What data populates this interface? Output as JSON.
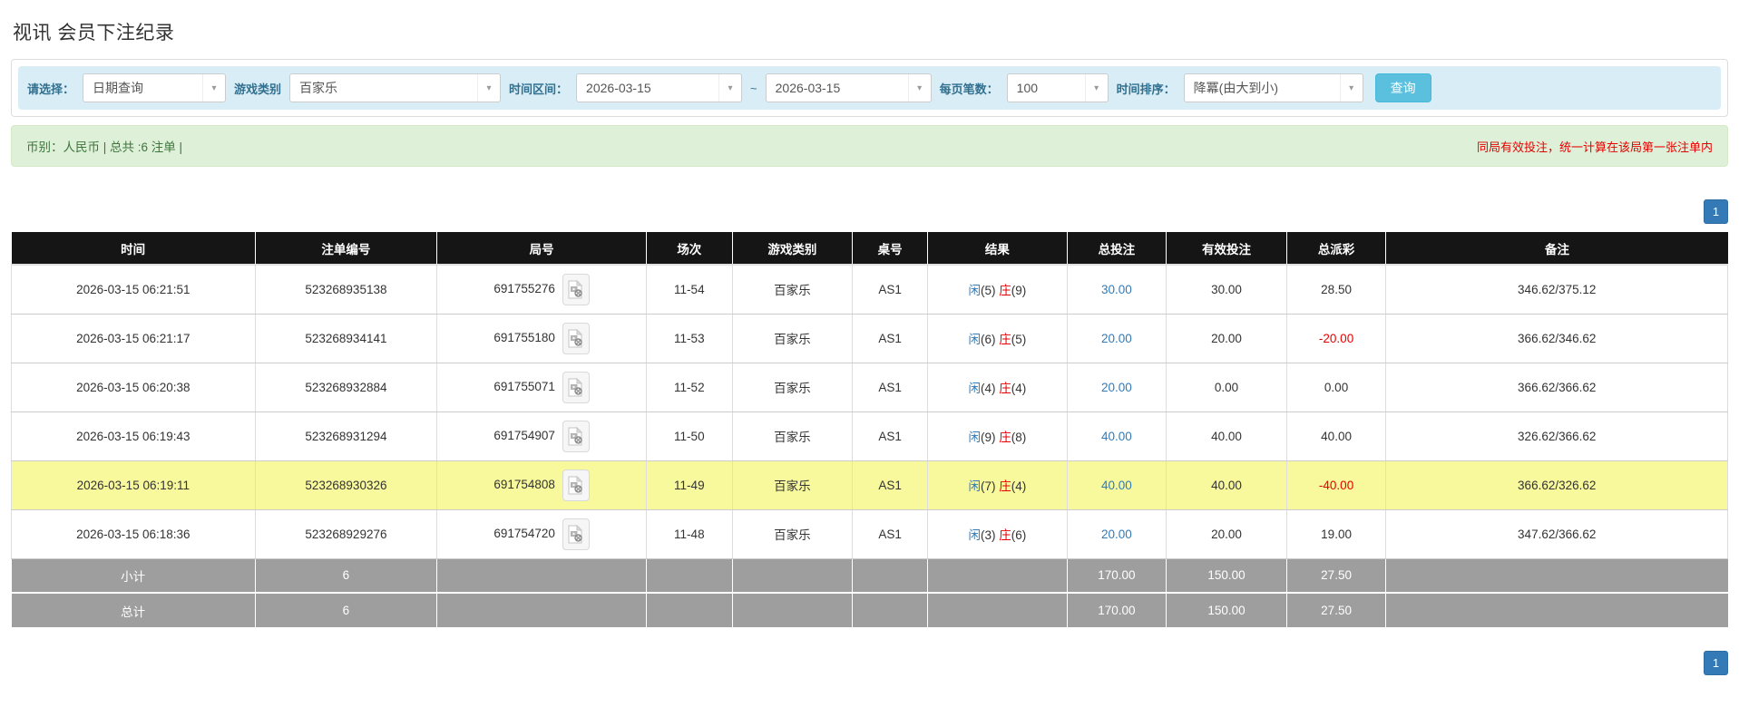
{
  "page": {
    "title": "视讯 会员下注纪录"
  },
  "icons": {
    "dropdown_caret": "▾"
  },
  "colors": {
    "accent_blue": "#337ab7",
    "search_button_cyan": "#5bc0de",
    "filter_bar_bg": "#d9edf7",
    "filter_label_blue": "#31708f",
    "summary_bg": "#dff0d8",
    "summary_text_green": "#3c763d",
    "warning_red": "#e60000",
    "header_bg": "#151515",
    "footer_gray": "#9e9e9e",
    "highlight_yellow": "#f8f89c"
  },
  "filters": {
    "select_label": "请选择：",
    "select_value": "日期查询",
    "game_type_label": "游戏类别",
    "game_type_value": "百家乐",
    "time_range_label": "时间区间：",
    "date_from": "2026-03-15",
    "tilde": "~",
    "date_to": "2026-03-15",
    "per_page_label": "每页笔数：",
    "per_page_value": "100",
    "sort_label": "时间排序：",
    "sort_value": "降冪(由大到小)",
    "search_button": "查询"
  },
  "summary": {
    "left": "币别：人民币 | 总共 :6 注单 |",
    "right_note": "同局有效投注，统一计算在该局第一张注单内"
  },
  "pagination": {
    "page": "1"
  },
  "table": {
    "headers": [
      "时间",
      "注单编号",
      "局号",
      "场次",
      "游戏类别",
      "桌号",
      "结果",
      "总投注",
      "有效投注",
      "总派彩",
      "备注"
    ],
    "rows": [
      {
        "time": "2026-03-15 06:21:51",
        "bet_id": "523268935138",
        "round_no": "691755276",
        "session": "11-54",
        "game": "百家乐",
        "table_no": "AS1",
        "result": {
          "player_label": "闲",
          "player_score": "(5)",
          "banker_label": "庄",
          "banker_score": "(9)"
        },
        "total_bet": "30.00",
        "valid_bet": "30.00",
        "payout": "28.50",
        "note": "346.62/375.12",
        "highlight": false
      },
      {
        "time": "2026-03-15 06:21:17",
        "bet_id": "523268934141",
        "round_no": "691755180",
        "session": "11-53",
        "game": "百家乐",
        "table_no": "AS1",
        "result": {
          "player_label": "闲",
          "player_score": "(6)",
          "banker_label": "庄",
          "banker_score": "(5)"
        },
        "total_bet": "20.00",
        "valid_bet": "20.00",
        "payout": "-20.00",
        "note": "366.62/346.62",
        "highlight": false
      },
      {
        "time": "2026-03-15 06:20:38",
        "bet_id": "523268932884",
        "round_no": "691755071",
        "session": "11-52",
        "game": "百家乐",
        "table_no": "AS1",
        "result": {
          "player_label": "闲",
          "player_score": "(4)",
          "banker_label": "庄",
          "banker_score": "(4)"
        },
        "total_bet": "20.00",
        "valid_bet": "0.00",
        "payout": "0.00",
        "note": "366.62/366.62",
        "highlight": false
      },
      {
        "time": "2026-03-15 06:19:43",
        "bet_id": "523268931294",
        "round_no": "691754907",
        "session": "11-50",
        "game": "百家乐",
        "table_no": "AS1",
        "result": {
          "player_label": "闲",
          "player_score": "(9)",
          "banker_label": "庄",
          "banker_score": "(8)"
        },
        "total_bet": "40.00",
        "valid_bet": "40.00",
        "payout": "40.00",
        "note": "326.62/366.62",
        "highlight": false
      },
      {
        "time": "2026-03-15 06:19:11",
        "bet_id": "523268930326",
        "round_no": "691754808",
        "session": "11-49",
        "game": "百家乐",
        "table_no": "AS1",
        "result": {
          "player_label": "闲",
          "player_score": "(7)",
          "banker_label": "庄",
          "banker_score": "(4)"
        },
        "total_bet": "40.00",
        "valid_bet": "40.00",
        "payout": "-40.00",
        "note": "366.62/326.62",
        "highlight": true
      },
      {
        "time": "2026-03-15 06:18:36",
        "bet_id": "523268929276",
        "round_no": "691754720",
        "session": "11-48",
        "game": "百家乐",
        "table_no": "AS1",
        "result": {
          "player_label": "闲",
          "player_score": "(3)",
          "banker_label": "庄",
          "banker_score": "(6)"
        },
        "total_bet": "20.00",
        "valid_bet": "20.00",
        "payout": "19.00",
        "note": "347.62/366.62",
        "highlight": false
      }
    ],
    "footer_rows": [
      {
        "label": "小计",
        "count": "6",
        "total_bet": "170.00",
        "valid_bet": "150.00",
        "payout": "27.50"
      },
      {
        "label": "总计",
        "count": "6",
        "total_bet": "170.00",
        "valid_bet": "150.00",
        "payout": "27.50"
      }
    ]
  }
}
